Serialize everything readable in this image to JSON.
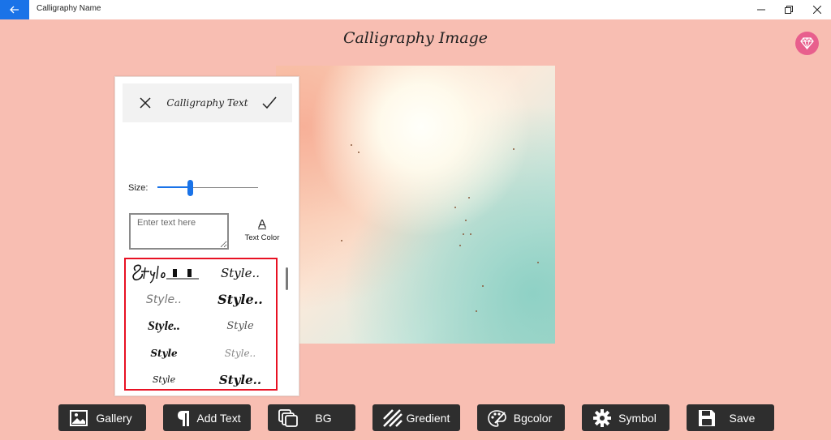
{
  "window": {
    "app_title": "Calligraphy Name",
    "back_icon": "back-arrow-icon",
    "controls": [
      "minimize-icon",
      "maximize-icon",
      "close-icon"
    ]
  },
  "page": {
    "title": "Calligraphy Image",
    "premium_icon": "diamond-icon",
    "accent_color": "#1a73e8",
    "background_color": "#f8beb2"
  },
  "panel": {
    "title": "Calligraphy Text",
    "close_icon": "close-icon",
    "confirm_icon": "checkmark-icon",
    "size_label": "Size:",
    "size_value_fraction": 0.3,
    "text_input": {
      "value": "",
      "placeholder": "Enter text here"
    },
    "text_color": {
      "icon_glyph": "A",
      "label": "Text Color"
    },
    "styles": [
      {
        "sample": "Style",
        "id": "style-1"
      },
      {
        "sample": "Style..",
        "id": "style-2"
      },
      {
        "sample": "Style..",
        "id": "style-3"
      },
      {
        "sample": "Style..",
        "id": "style-4"
      },
      {
        "sample": "Style..",
        "id": "style-5"
      },
      {
        "sample": "Style",
        "id": "style-6"
      },
      {
        "sample": "Style",
        "id": "style-7"
      },
      {
        "sample": "Style..",
        "id": "style-8"
      },
      {
        "sample": "Style",
        "id": "style-9"
      },
      {
        "sample": "Style..",
        "id": "style-10"
      }
    ],
    "selection_color": "#e81123"
  },
  "toolbar": {
    "gallery": "Gallery",
    "add_text": "Add Text",
    "bg": "BG",
    "gradient": "Gredient",
    "bgcolor": "Bgcolor",
    "symbol": "Symbol",
    "save": "Save"
  }
}
